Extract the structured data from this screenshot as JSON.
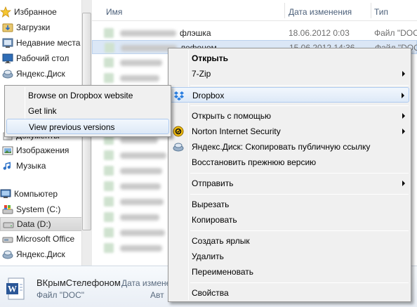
{
  "nav": {
    "items": [
      {
        "label": "Избранное",
        "icon": "star-icon"
      },
      {
        "label": "Загрузки",
        "icon": "downloads-folder-icon"
      },
      {
        "label": "Недавние места",
        "icon": "recent-places-icon"
      },
      {
        "label": "Рабочий стол",
        "icon": "desktop-icon"
      },
      {
        "label": "Яндекс.Диск",
        "icon": "yandex-disk-icon"
      },
      {
        "label": "Документы",
        "icon": "documents-library-icon"
      },
      {
        "label": "Изображения",
        "icon": "pictures-library-icon"
      },
      {
        "label": "Музыка",
        "icon": "music-library-icon"
      },
      {
        "label": "Компьютер",
        "icon": "computer-icon"
      },
      {
        "label": "System (C:)",
        "icon": "system-drive-icon"
      },
      {
        "label": "Data (D:)",
        "icon": "hard-drive-icon"
      },
      {
        "label": "Microsoft Office",
        "icon": "network-drive-icon"
      },
      {
        "label": "Яндекс.Диск",
        "icon": "yandex-disk-icon"
      }
    ]
  },
  "list": {
    "headers": {
      "name": "Имя",
      "date": "Дата изменения",
      "type": "Тип"
    },
    "rows": [
      {
        "name": "флэшка",
        "date": "18.06.2012 0:03",
        "type": "Файл \"DOC"
      },
      {
        "name": "лефоном",
        "date": "15.06.2012 14:36",
        "type": "Файл \"DOC"
      }
    ]
  },
  "context_menu": {
    "items": [
      {
        "label": "Открыть",
        "bold": true
      },
      {
        "label": "7-Zip",
        "submenu": true
      },
      {
        "label": "Dropbox",
        "submenu": true,
        "icon": "dropbox-icon"
      },
      {
        "label": "Открыть с помощью",
        "submenu": true
      },
      {
        "label": "Norton Internet Security",
        "submenu": true,
        "icon": "norton-icon"
      },
      {
        "label": "Яндекс.Диск: Скопировать публичную ссылку",
        "icon": "yandex-disk-icon"
      },
      {
        "label": "Восстановить прежнюю версию"
      },
      {
        "label": "Отправить",
        "submenu": true
      },
      {
        "label": "Вырезать"
      },
      {
        "label": "Копировать"
      },
      {
        "label": "Создать ярлык"
      },
      {
        "label": "Удалить"
      },
      {
        "label": "Переименовать"
      },
      {
        "label": "Свойства"
      }
    ]
  },
  "dropbox_submenu": {
    "items": [
      {
        "label": "Browse on Dropbox website"
      },
      {
        "label": "Get link"
      },
      {
        "label": "View previous versions"
      }
    ]
  },
  "details": {
    "filename": "ВКрымСтелефоном",
    "date_label": "Дата измене",
    "type_label": "Файл \"DOC\"",
    "author_label": "Авт"
  },
  "colors": {
    "menu_hover": "#dde9f7",
    "selection": "#dbe7f6",
    "header_text": "#4c607a"
  }
}
